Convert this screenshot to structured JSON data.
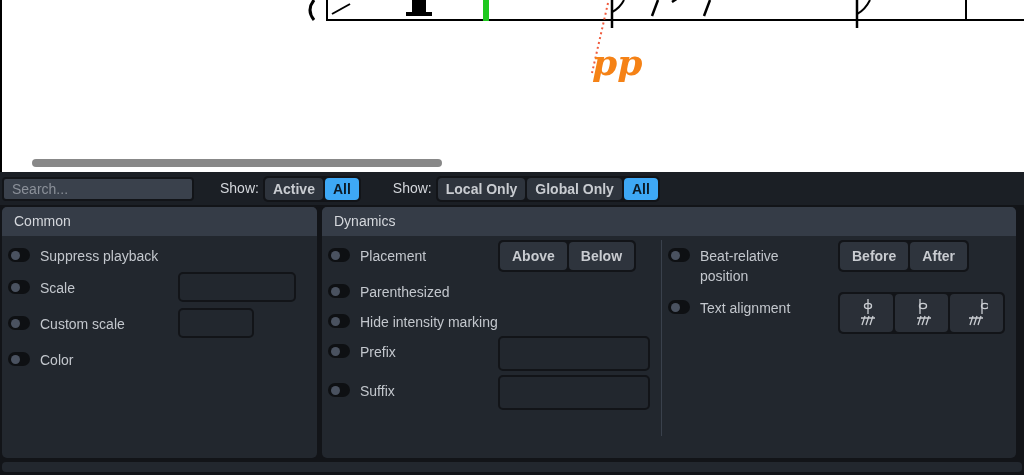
{
  "score": {
    "dynamic": "pp"
  },
  "toolbar": {
    "search": {
      "placeholder": "Search..."
    },
    "filters": [
      {
        "label": "Show:",
        "options": [
          {
            "label": "Active",
            "selected": false
          },
          {
            "label": "All",
            "selected": true
          }
        ]
      },
      {
        "label": "Show:",
        "options": [
          {
            "label": "Local Only",
            "selected": false
          },
          {
            "label": "Global Only",
            "selected": false
          },
          {
            "label": "All",
            "selected": true
          }
        ]
      }
    ]
  },
  "common": {
    "title": "Common",
    "rows": [
      {
        "kind": "plain",
        "label": "Suppress playback",
        "on": false
      },
      {
        "kind": "widefield",
        "label": "Scale",
        "on": false
      },
      {
        "kind": "narrowfield",
        "label": "Custom scale",
        "on": false
      },
      {
        "kind": "plain",
        "label": "Color",
        "on": false
      }
    ]
  },
  "dynamics": {
    "title": "Dynamics",
    "left": [
      {
        "kind": "segmented",
        "label": "Placement",
        "on": false,
        "options": [
          {
            "label": "Above",
            "selected": false
          },
          {
            "label": "Below",
            "selected": false
          }
        ]
      },
      {
        "kind": "plain",
        "label": "Parenthesized",
        "on": false
      },
      {
        "kind": "plain",
        "label": "Hide intensity marking",
        "on": false
      },
      {
        "kind": "largefield",
        "label": "Prefix",
        "on": false
      },
      {
        "kind": "largefield",
        "label": "Suffix",
        "on": false
      }
    ],
    "right": [
      {
        "kind": "segmented",
        "label": "Beat-relative position",
        "on": false,
        "options": [
          {
            "label": "Before",
            "selected": false
          },
          {
            "label": "After",
            "selected": false
          }
        ]
      },
      {
        "kind": "icons",
        "label": "Text alignment",
        "on": false,
        "options": [
          {
            "kind": "center",
            "selected": false
          },
          {
            "kind": "left",
            "selected": false
          },
          {
            "kind": "right",
            "selected": false
          }
        ]
      }
    ]
  }
}
